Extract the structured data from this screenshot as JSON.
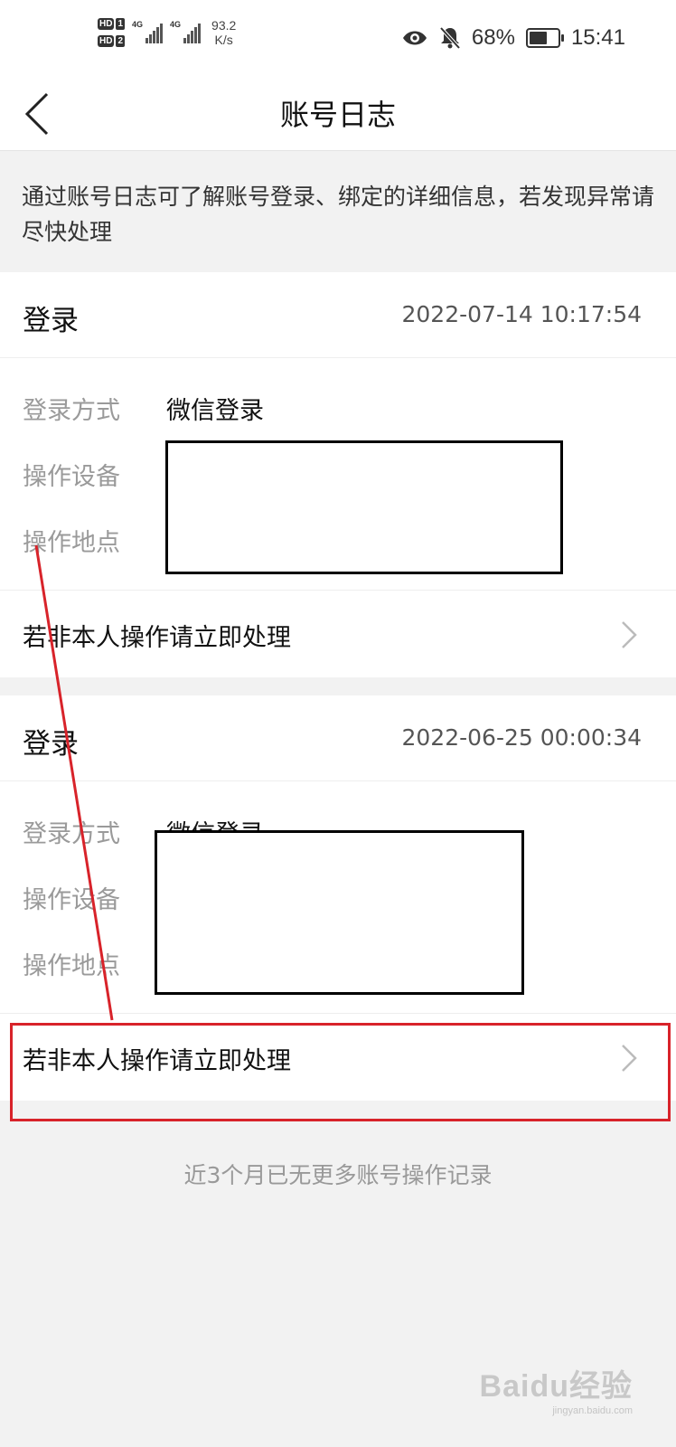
{
  "status_bar": {
    "hd1": "HD",
    "hd1_num": "1",
    "hd2": "HD",
    "hd2_num": "2",
    "sig1_label": "4G",
    "sig2_label": "4G",
    "speed_value": "93.2",
    "speed_unit": "K/s",
    "battery_percent": "68%",
    "battery_level": 0.68,
    "time": "15:41",
    "icons": [
      "eye-icon",
      "bell-muted-icon",
      "battery-icon"
    ]
  },
  "header": {
    "title": "账号日志",
    "back_icon": "chevron-left-icon"
  },
  "notice": "通过账号日志可了解账号登录、绑定的详细信息，若发现异常请尽快处理",
  "logs": [
    {
      "type": "登录",
      "time": "2022-07-14 10:17:54",
      "method_label": "登录方式",
      "method_value": "微信登录",
      "device_label": "操作设备",
      "location_label": "操作地点",
      "action": "若非本人操作请立即处理"
    },
    {
      "type": "登录",
      "time": "2022-06-25 00:00:34",
      "method_label": "登录方式",
      "method_value": "微信登录",
      "device_label": "操作设备",
      "location_label": "操作地点",
      "action": "若非本人操作请立即处理"
    }
  ],
  "footer": "近3个月已无更多账号操作记录",
  "watermark": {
    "brand": "Baidu经验",
    "url": "jingyan.baidu.com"
  },
  "colors": {
    "annotation_red": "#d8232a",
    "background": "#f2f2f2",
    "label_gray": "#9a9a9a"
  }
}
